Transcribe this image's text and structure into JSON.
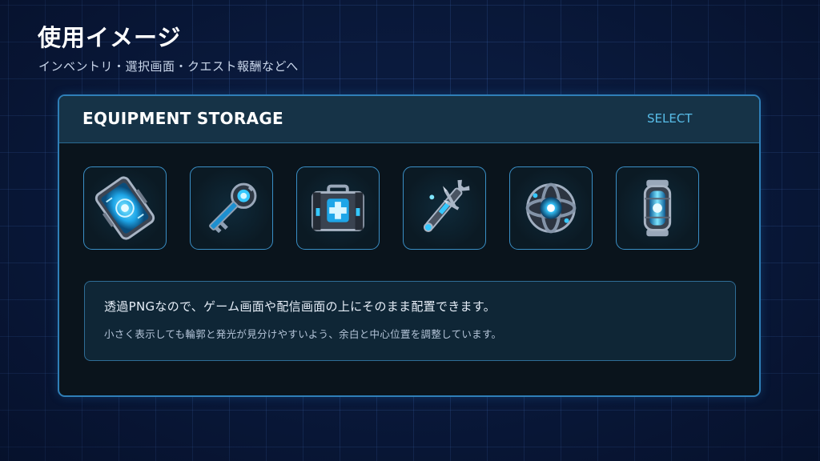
{
  "page": {
    "title": "使用イメージ",
    "subtitle": "インベントリ・選択画面・クエスト報酬などへ"
  },
  "panel": {
    "title": "EQUIPMENT STORAGE",
    "select_label": "SELECT",
    "accent_color": "#2f7fb8",
    "header_color": "#163347"
  },
  "slots": [
    {
      "icon": "holo-tablet-icon"
    },
    {
      "icon": "tech-key-icon"
    },
    {
      "icon": "toolbox-case-icon"
    },
    {
      "icon": "multitool-wrench-icon"
    },
    {
      "icon": "energy-orb-icon"
    },
    {
      "icon": "energy-capsule-icon"
    }
  ],
  "info": {
    "main": "透過PNGなので、ゲーム画面や配信画面の上にそのまま配置できます。",
    "sub": "小さく表示しても輪郭と発光が見分けやすいよう、余白と中心位置を調整しています。"
  },
  "colors": {
    "background": "#0a1a3d",
    "glow": "#35c8ff",
    "metal": "#8a96a8"
  }
}
